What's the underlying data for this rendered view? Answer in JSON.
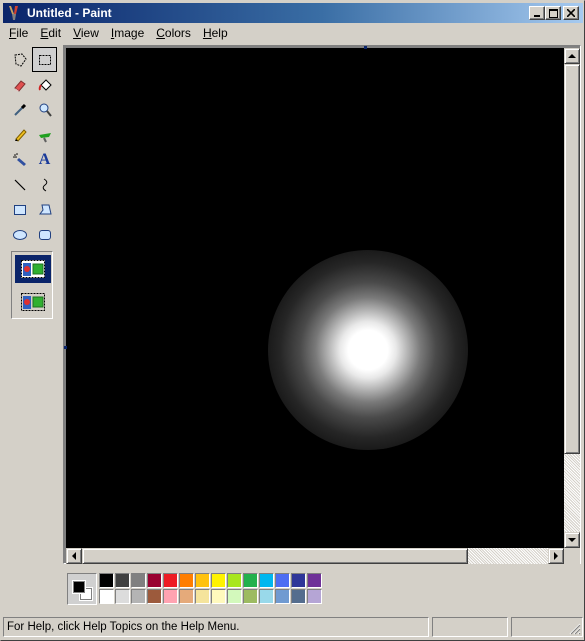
{
  "window": {
    "title": "Untitled - Paint",
    "icon": "paint-brush-icon",
    "controls": [
      "minimize-icon",
      "maximize-icon",
      "close-icon"
    ]
  },
  "menu": [
    {
      "label": "File",
      "hotkey": "F"
    },
    {
      "label": "Edit",
      "hotkey": "E"
    },
    {
      "label": "View",
      "hotkey": "V"
    },
    {
      "label": "Image",
      "hotkey": "I"
    },
    {
      "label": "Colors",
      "hotkey": "C"
    },
    {
      "label": "Help",
      "hotkey": "H"
    }
  ],
  "tools": [
    {
      "name": "free-form-select",
      "icon": "free-form-select-icon",
      "selected": false
    },
    {
      "name": "rectangle-select",
      "icon": "rectangle-select-icon",
      "selected": true
    },
    {
      "name": "eraser",
      "icon": "eraser-icon",
      "selected": false
    },
    {
      "name": "fill",
      "icon": "fill-bucket-icon",
      "selected": false
    },
    {
      "name": "pick-color",
      "icon": "eyedropper-icon",
      "selected": false
    },
    {
      "name": "magnifier",
      "icon": "magnifier-icon",
      "selected": false
    },
    {
      "name": "pencil",
      "icon": "pencil-icon",
      "selected": false
    },
    {
      "name": "brush",
      "icon": "brush-icon",
      "selected": false
    },
    {
      "name": "airbrush",
      "icon": "airbrush-icon",
      "selected": false
    },
    {
      "name": "text",
      "icon": "text-icon",
      "glyph": "A",
      "selected": false
    },
    {
      "name": "line",
      "icon": "line-icon",
      "selected": false
    },
    {
      "name": "curve",
      "icon": "curve-icon",
      "selected": false
    },
    {
      "name": "rectangle",
      "icon": "rectangle-icon",
      "selected": false
    },
    {
      "name": "polygon",
      "icon": "polygon-icon",
      "selected": false
    },
    {
      "name": "ellipse",
      "icon": "ellipse-icon",
      "selected": false
    },
    {
      "name": "rounded-rectangle",
      "icon": "rounded-rectangle-icon",
      "selected": false
    }
  ],
  "tool_options": [
    {
      "name": "opaque-selection",
      "icon": "opaque-selection-icon",
      "selected": true
    },
    {
      "name": "transparent-selection",
      "icon": "transparent-selection-icon",
      "selected": false
    }
  ],
  "canvas": {
    "background": "#000000",
    "content": "white radial glow"
  },
  "colors": {
    "foreground": "#000000",
    "background": "#ffffff",
    "palette_top": [
      "#000000",
      "#404040",
      "#808080",
      "#990030",
      "#ed1c24",
      "#ff7e00",
      "#ffc20e",
      "#fff200",
      "#a8e61d",
      "#22b14c",
      "#00b7ef",
      "#4d6df3",
      "#2f3699",
      "#6f3198"
    ],
    "palette_bottom": [
      "#ffffff",
      "#dcdcdc",
      "#b4b4b4",
      "#9c5a3c",
      "#ffa3b1",
      "#e5aa7a",
      "#f5e49c",
      "#fff9bd",
      "#d3f9bc",
      "#9dbb61",
      "#99d9ea",
      "#709ad1",
      "#546d8e",
      "#b5a5d5"
    ]
  },
  "status": {
    "help_text": "For Help, click Help Topics on the Help Menu."
  }
}
